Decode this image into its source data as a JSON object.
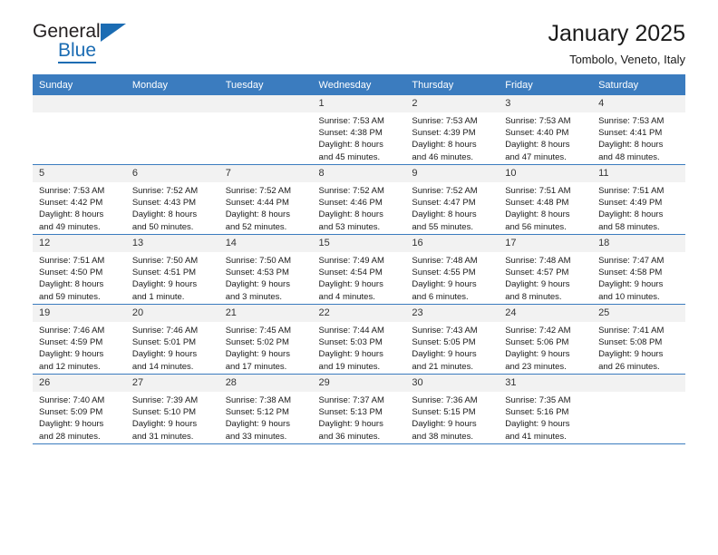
{
  "brand": {
    "name_part1": "General",
    "name_part2": "Blue",
    "triangle_color": "#1b6cb3"
  },
  "header": {
    "title": "January 2025",
    "subtitle": "Tombolo, Veneto, Italy"
  },
  "theme": {
    "header_blue": "#3b7cbf",
    "daynum_bg": "#f2f2f2",
    "text": "#1a1a1a"
  },
  "weekdays": [
    "Sunday",
    "Monday",
    "Tuesday",
    "Wednesday",
    "Thursday",
    "Friday",
    "Saturday"
  ],
  "weeks": [
    [
      {
        "day": "",
        "sunrise": "",
        "sunset": "",
        "daylight1": "",
        "daylight2": ""
      },
      {
        "day": "",
        "sunrise": "",
        "sunset": "",
        "daylight1": "",
        "daylight2": ""
      },
      {
        "day": "",
        "sunrise": "",
        "sunset": "",
        "daylight1": "",
        "daylight2": ""
      },
      {
        "day": "1",
        "sunrise": "Sunrise: 7:53 AM",
        "sunset": "Sunset: 4:38 PM",
        "daylight1": "Daylight: 8 hours",
        "daylight2": "and 45 minutes."
      },
      {
        "day": "2",
        "sunrise": "Sunrise: 7:53 AM",
        "sunset": "Sunset: 4:39 PM",
        "daylight1": "Daylight: 8 hours",
        "daylight2": "and 46 minutes."
      },
      {
        "day": "3",
        "sunrise": "Sunrise: 7:53 AM",
        "sunset": "Sunset: 4:40 PM",
        "daylight1": "Daylight: 8 hours",
        "daylight2": "and 47 minutes."
      },
      {
        "day": "4",
        "sunrise": "Sunrise: 7:53 AM",
        "sunset": "Sunset: 4:41 PM",
        "daylight1": "Daylight: 8 hours",
        "daylight2": "and 48 minutes."
      }
    ],
    [
      {
        "day": "5",
        "sunrise": "Sunrise: 7:53 AM",
        "sunset": "Sunset: 4:42 PM",
        "daylight1": "Daylight: 8 hours",
        "daylight2": "and 49 minutes."
      },
      {
        "day": "6",
        "sunrise": "Sunrise: 7:52 AM",
        "sunset": "Sunset: 4:43 PM",
        "daylight1": "Daylight: 8 hours",
        "daylight2": "and 50 minutes."
      },
      {
        "day": "7",
        "sunrise": "Sunrise: 7:52 AM",
        "sunset": "Sunset: 4:44 PM",
        "daylight1": "Daylight: 8 hours",
        "daylight2": "and 52 minutes."
      },
      {
        "day": "8",
        "sunrise": "Sunrise: 7:52 AM",
        "sunset": "Sunset: 4:46 PM",
        "daylight1": "Daylight: 8 hours",
        "daylight2": "and 53 minutes."
      },
      {
        "day": "9",
        "sunrise": "Sunrise: 7:52 AM",
        "sunset": "Sunset: 4:47 PM",
        "daylight1": "Daylight: 8 hours",
        "daylight2": "and 55 minutes."
      },
      {
        "day": "10",
        "sunrise": "Sunrise: 7:51 AM",
        "sunset": "Sunset: 4:48 PM",
        "daylight1": "Daylight: 8 hours",
        "daylight2": "and 56 minutes."
      },
      {
        "day": "11",
        "sunrise": "Sunrise: 7:51 AM",
        "sunset": "Sunset: 4:49 PM",
        "daylight1": "Daylight: 8 hours",
        "daylight2": "and 58 minutes."
      }
    ],
    [
      {
        "day": "12",
        "sunrise": "Sunrise: 7:51 AM",
        "sunset": "Sunset: 4:50 PM",
        "daylight1": "Daylight: 8 hours",
        "daylight2": "and 59 minutes."
      },
      {
        "day": "13",
        "sunrise": "Sunrise: 7:50 AM",
        "sunset": "Sunset: 4:51 PM",
        "daylight1": "Daylight: 9 hours",
        "daylight2": "and 1 minute."
      },
      {
        "day": "14",
        "sunrise": "Sunrise: 7:50 AM",
        "sunset": "Sunset: 4:53 PM",
        "daylight1": "Daylight: 9 hours",
        "daylight2": "and 3 minutes."
      },
      {
        "day": "15",
        "sunrise": "Sunrise: 7:49 AM",
        "sunset": "Sunset: 4:54 PM",
        "daylight1": "Daylight: 9 hours",
        "daylight2": "and 4 minutes."
      },
      {
        "day": "16",
        "sunrise": "Sunrise: 7:48 AM",
        "sunset": "Sunset: 4:55 PM",
        "daylight1": "Daylight: 9 hours",
        "daylight2": "and 6 minutes."
      },
      {
        "day": "17",
        "sunrise": "Sunrise: 7:48 AM",
        "sunset": "Sunset: 4:57 PM",
        "daylight1": "Daylight: 9 hours",
        "daylight2": "and 8 minutes."
      },
      {
        "day": "18",
        "sunrise": "Sunrise: 7:47 AM",
        "sunset": "Sunset: 4:58 PM",
        "daylight1": "Daylight: 9 hours",
        "daylight2": "and 10 minutes."
      }
    ],
    [
      {
        "day": "19",
        "sunrise": "Sunrise: 7:46 AM",
        "sunset": "Sunset: 4:59 PM",
        "daylight1": "Daylight: 9 hours",
        "daylight2": "and 12 minutes."
      },
      {
        "day": "20",
        "sunrise": "Sunrise: 7:46 AM",
        "sunset": "Sunset: 5:01 PM",
        "daylight1": "Daylight: 9 hours",
        "daylight2": "and 14 minutes."
      },
      {
        "day": "21",
        "sunrise": "Sunrise: 7:45 AM",
        "sunset": "Sunset: 5:02 PM",
        "daylight1": "Daylight: 9 hours",
        "daylight2": "and 17 minutes."
      },
      {
        "day": "22",
        "sunrise": "Sunrise: 7:44 AM",
        "sunset": "Sunset: 5:03 PM",
        "daylight1": "Daylight: 9 hours",
        "daylight2": "and 19 minutes."
      },
      {
        "day": "23",
        "sunrise": "Sunrise: 7:43 AM",
        "sunset": "Sunset: 5:05 PM",
        "daylight1": "Daylight: 9 hours",
        "daylight2": "and 21 minutes."
      },
      {
        "day": "24",
        "sunrise": "Sunrise: 7:42 AM",
        "sunset": "Sunset: 5:06 PM",
        "daylight1": "Daylight: 9 hours",
        "daylight2": "and 23 minutes."
      },
      {
        "day": "25",
        "sunrise": "Sunrise: 7:41 AM",
        "sunset": "Sunset: 5:08 PM",
        "daylight1": "Daylight: 9 hours",
        "daylight2": "and 26 minutes."
      }
    ],
    [
      {
        "day": "26",
        "sunrise": "Sunrise: 7:40 AM",
        "sunset": "Sunset: 5:09 PM",
        "daylight1": "Daylight: 9 hours",
        "daylight2": "and 28 minutes."
      },
      {
        "day": "27",
        "sunrise": "Sunrise: 7:39 AM",
        "sunset": "Sunset: 5:10 PM",
        "daylight1": "Daylight: 9 hours",
        "daylight2": "and 31 minutes."
      },
      {
        "day": "28",
        "sunrise": "Sunrise: 7:38 AM",
        "sunset": "Sunset: 5:12 PM",
        "daylight1": "Daylight: 9 hours",
        "daylight2": "and 33 minutes."
      },
      {
        "day": "29",
        "sunrise": "Sunrise: 7:37 AM",
        "sunset": "Sunset: 5:13 PM",
        "daylight1": "Daylight: 9 hours",
        "daylight2": "and 36 minutes."
      },
      {
        "day": "30",
        "sunrise": "Sunrise: 7:36 AM",
        "sunset": "Sunset: 5:15 PM",
        "daylight1": "Daylight: 9 hours",
        "daylight2": "and 38 minutes."
      },
      {
        "day": "31",
        "sunrise": "Sunrise: 7:35 AM",
        "sunset": "Sunset: 5:16 PM",
        "daylight1": "Daylight: 9 hours",
        "daylight2": "and 41 minutes."
      },
      {
        "day": "",
        "sunrise": "",
        "sunset": "",
        "daylight1": "",
        "daylight2": ""
      }
    ]
  ]
}
